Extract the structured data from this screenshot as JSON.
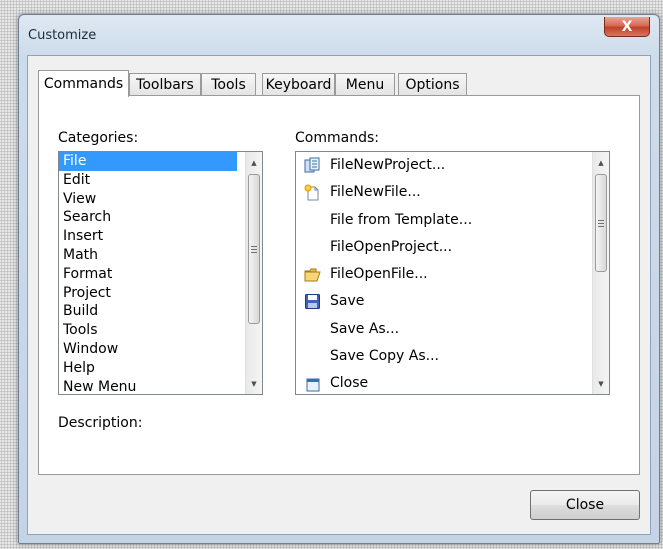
{
  "window": {
    "title": "Customize",
    "close_glyph": "X"
  },
  "tabs": [
    {
      "label": "Commands",
      "active": true
    },
    {
      "label": "Toolbars",
      "active": false
    },
    {
      "label": "Tools",
      "active": false
    },
    {
      "label": "Keyboard",
      "active": false
    },
    {
      "label": "Menu",
      "active": false
    },
    {
      "label": "Options",
      "active": false
    }
  ],
  "categories": {
    "label": "Categories:",
    "items": [
      "File",
      "Edit",
      "View",
      "Search",
      "Insert",
      "Math",
      "Format",
      "Project",
      "Build",
      "Tools",
      "Window",
      "Help",
      "New Menu"
    ],
    "selected": "File"
  },
  "commands": {
    "label": "Commands:",
    "items": [
      {
        "label": "FileNewProject...",
        "icon": "new-project-icon"
      },
      {
        "label": "FileNewFile...",
        "icon": "new-file-icon"
      },
      {
        "label": "File from Template...",
        "icon": ""
      },
      {
        "label": "FileOpenProject...",
        "icon": ""
      },
      {
        "label": "FileOpenFile...",
        "icon": "open-folder-icon"
      },
      {
        "label": "Save",
        "icon": "floppy-disk-icon"
      },
      {
        "label": "Save As...",
        "icon": ""
      },
      {
        "label": "Save Copy As...",
        "icon": ""
      },
      {
        "label": "Close",
        "icon": "close-document-icon"
      }
    ]
  },
  "description": {
    "label": "Description:"
  },
  "footer": {
    "close_label": "Close"
  },
  "colors": {
    "selection": "#3399ff",
    "title_close": "#c1412a"
  }
}
